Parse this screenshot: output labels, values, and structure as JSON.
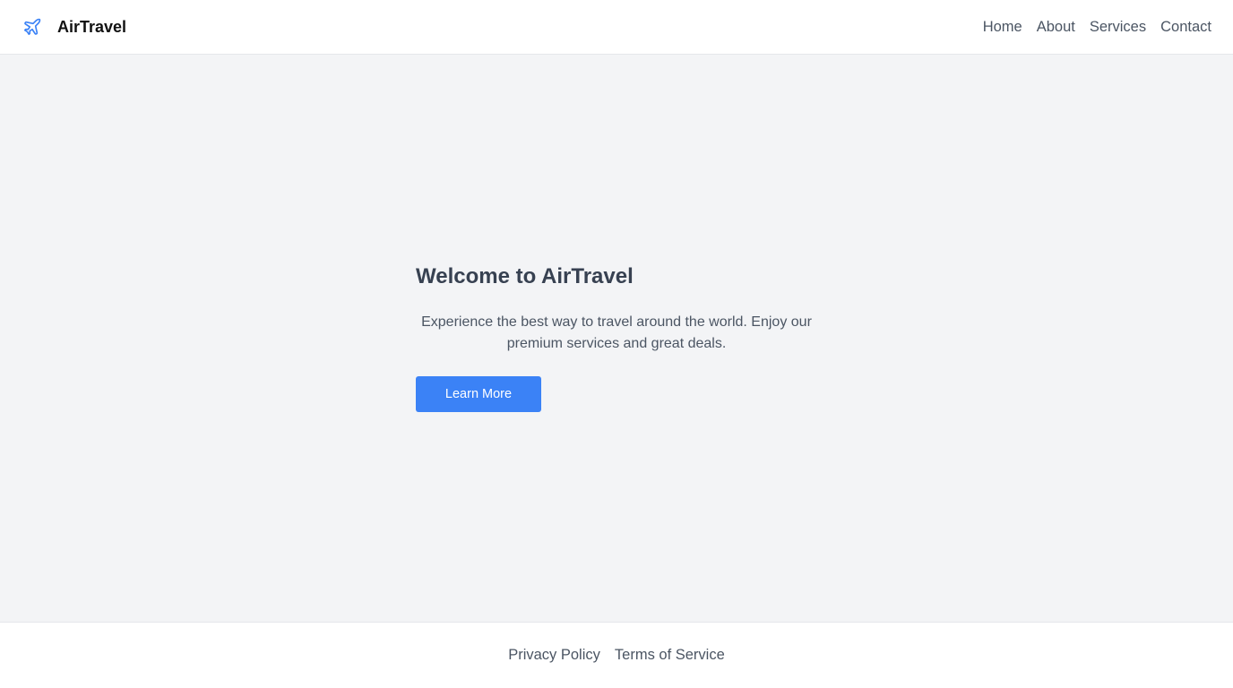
{
  "header": {
    "brand_name": "AirTravel",
    "brand_icon": "airplane-icon",
    "nav": [
      {
        "label": "Home"
      },
      {
        "label": "About"
      },
      {
        "label": "Services"
      },
      {
        "label": "Contact"
      }
    ]
  },
  "hero": {
    "title": "Welcome to AirTravel",
    "text": "Experience the best way to travel around the world. Enjoy our premium services and great deals.",
    "button_label": "Learn More"
  },
  "footer": {
    "links": [
      {
        "label": "Privacy Policy"
      },
      {
        "label": "Terms of Service"
      }
    ]
  },
  "colors": {
    "accent": "#3b82f6",
    "background": "#f3f4f6",
    "header_bg": "#ffffff"
  }
}
